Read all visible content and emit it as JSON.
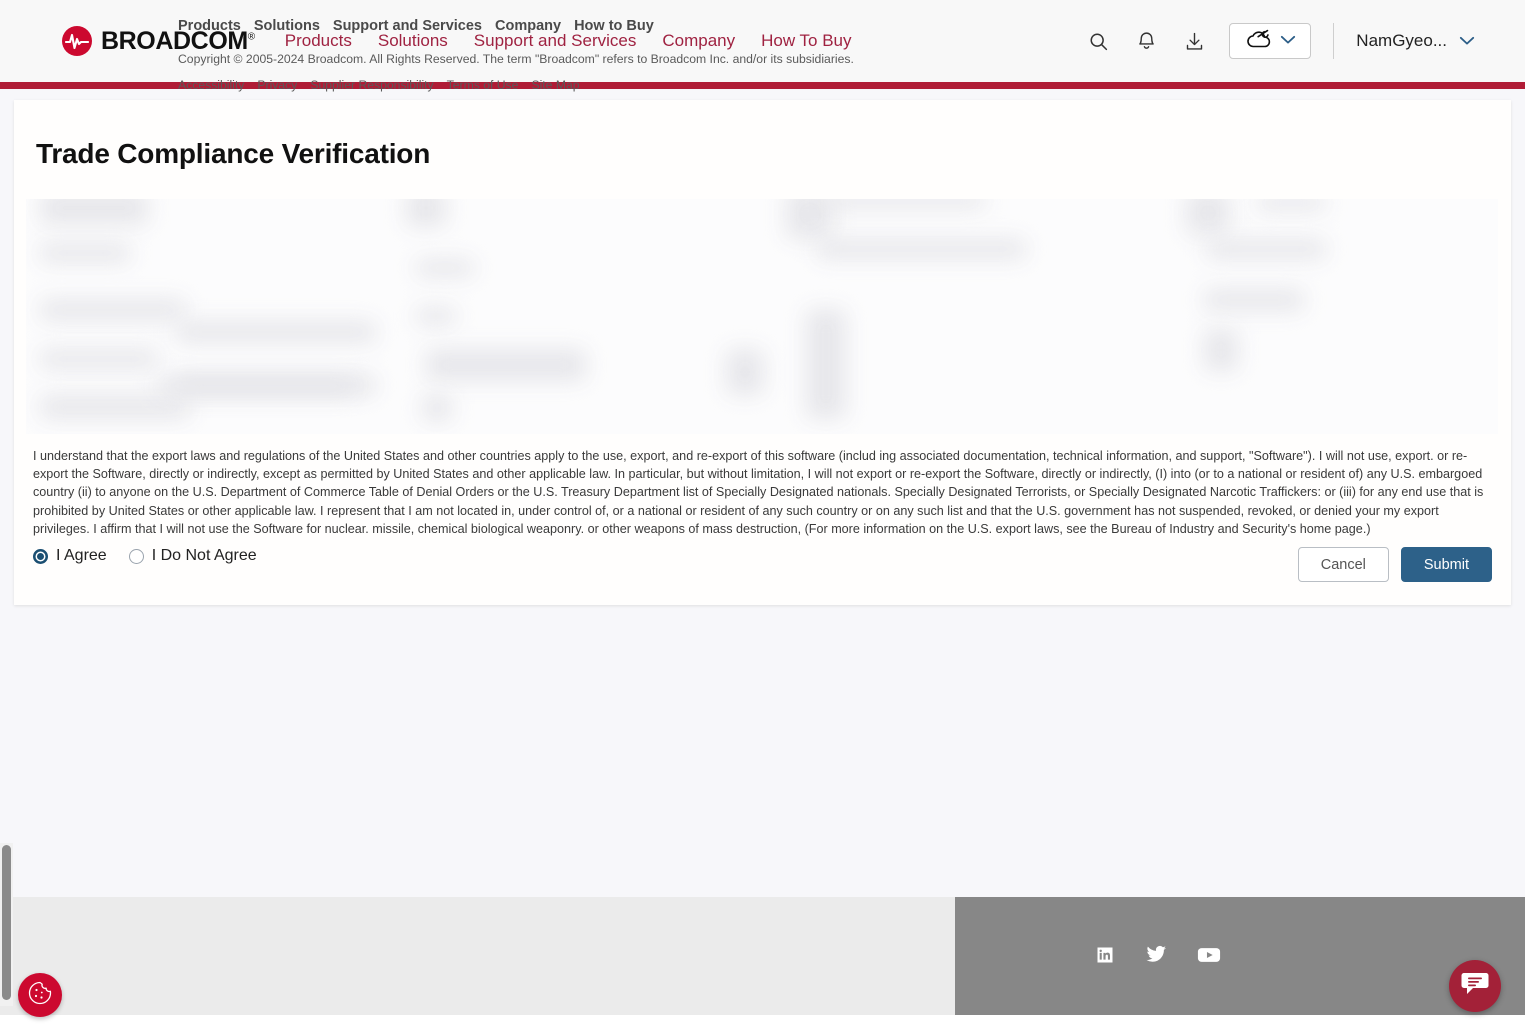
{
  "header": {
    "brand": "BROADCOM",
    "brand_registered": "®",
    "nav": [
      {
        "label": "Products"
      },
      {
        "label": "Solutions"
      },
      {
        "label": "Support and Services"
      },
      {
        "label": "Company"
      },
      {
        "label": "How To Buy"
      }
    ],
    "icons": {
      "search": "search-icon",
      "notifications": "bell-icon",
      "downloads": "download-icon",
      "cloud": "cloud-icon",
      "chevron": "chevron-down-icon"
    },
    "user": {
      "name": "NamGyeo...",
      "chevron": "chevron-down-icon"
    },
    "accent_red": "#b01c36",
    "nav_link_color": "#9f2241"
  },
  "main": {
    "title": "Trade Compliance Verification",
    "redacted_note": "",
    "legal_text": "I understand that the export laws and regulations of the United States and other countries apply to the use, export, and re-export of this software (includ ing associated documentation, technical information, and support, \"Software\"). I will not use, export. or re-export the Software, directly or indirectly, except as permitted by United States and other applicable law. In particular, but without limitation, I will not export or re-export the Software, directly or indirectly, (I) into (or to a national or resident of) any U.S. embargoed country (ii) to anyone on the U.S. Department of Commerce Table of Denial Orders or the U.S. Treasury Department list of Specially Designated nationals. Specially Designated Terrorists, or Specially Designated Narcotic Traffickers: or (iii) for any end use that is prohibited by United States or other applicable law. I represent that I am not located in, under control of, or a national or resident of any such country or on any such list and that the U.S. government has not suspended, revoked, or denied your my export privileges. I affirm that I will not use the Software for nuclear. missile, chemical biological weaponry. or other weapons of mass destruction, (For more information on the U.S. export laws, see the Bureau of Industry and Security's home page.)",
    "options": {
      "agree_label": "I Agree",
      "disagree_label": "I Do Not Agree",
      "selected": "I Agree"
    },
    "buttons": {
      "cancel": "Cancel",
      "submit": "Submit",
      "submit_color": "#2d6189"
    }
  },
  "footer": {
    "nav": [
      {
        "label": "Products"
      },
      {
        "label": "Solutions"
      },
      {
        "label": "Support and Services"
      },
      {
        "label": "Company"
      },
      {
        "label": "How to Buy"
      }
    ],
    "copyright": "Copyright © 2005-2024 Broadcom. All Rights Reserved. The term \"Broadcom\" refers to Broadcom Inc. and/or its subsidiaries.",
    "links": [
      {
        "label": "Accessibility"
      },
      {
        "label": "Privacy"
      },
      {
        "label": "Supplier Responsibility"
      },
      {
        "label": "Terms of Use"
      },
      {
        "label": "Site Map"
      }
    ],
    "social": [
      {
        "name": "linkedin-icon"
      },
      {
        "name": "twitter-icon"
      },
      {
        "name": "youtube-icon"
      }
    ],
    "bg_left": "#ebebeb",
    "bg_right": "#878787"
  },
  "widgets": {
    "cookie": "cookie-icon",
    "chat": "chat-bubble-icon",
    "cookie_color": "#cc092f",
    "chat_color": "#a32138"
  }
}
